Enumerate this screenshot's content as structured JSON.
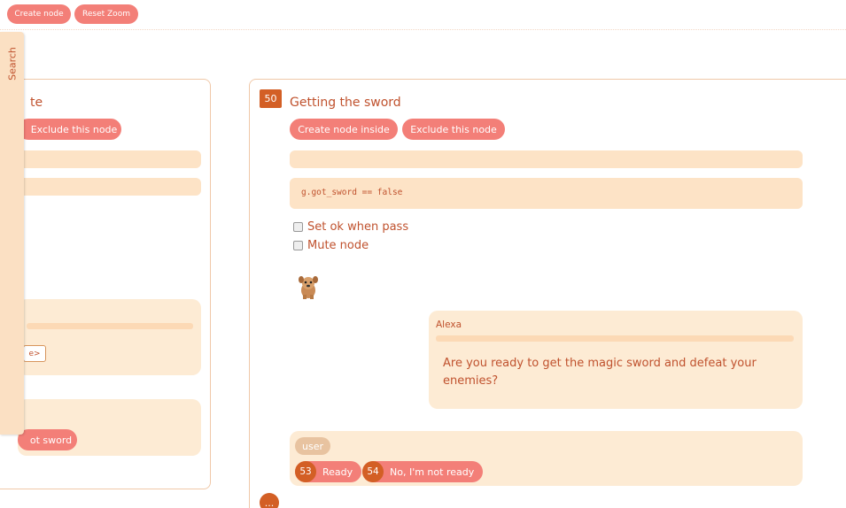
{
  "toolbar": {
    "create_node_label": "Create node",
    "reset_zoom_label": "Reset Zoom"
  },
  "search_tab": {
    "label": "Search"
  },
  "left_node": {
    "title_fragment": "te",
    "exclude_label": "Exclude this node",
    "small_box_label": "e>",
    "answer_fragment": "ot sword"
  },
  "main_node": {
    "id": "50",
    "title": "Getting the sword",
    "create_inside_label": "Create node inside",
    "exclude_label": "Exclude this node",
    "condition_code": "g.got_sword == false",
    "set_ok_label": "Set ok when pass",
    "mute_label": "Mute node",
    "npc": {
      "speaker": "Alexa",
      "message": "Are you ready to get the magic sword and defeat your enemies?"
    },
    "user": {
      "tag": "user",
      "answers": [
        {
          "id": "53",
          "label": "Ready"
        },
        {
          "id": "54",
          "label": "No, I'm not ready"
        }
      ]
    },
    "more_label": "..."
  },
  "colors": {
    "accent": "#f37f78",
    "badge": "#d35f25",
    "panel": "#fde3c6",
    "text": "#c0522e"
  }
}
